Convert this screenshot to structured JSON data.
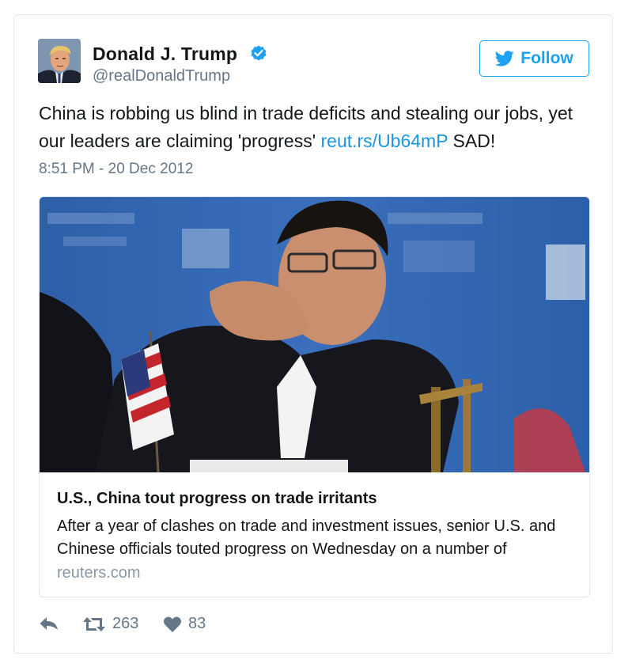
{
  "tweet": {
    "author": {
      "display_name": "Donald J. Trump",
      "handle": "@realDonaldTrump",
      "verified": true
    },
    "follow_label": "Follow",
    "text_before": "China is robbing us blind in trade deficits and stealing our jobs, yet our leaders are claiming 'progress' ",
    "link_text": "reut.rs/Ub64mP",
    "text_after": " SAD!",
    "timestamp": "8:51 PM - 20 Dec 2012",
    "card": {
      "title": "U.S., China tout progress on trade irritants",
      "description": "After a year of clashes on trade and investment issues, senior U.S. and Chinese officials touted progress on Wednesday on a number of",
      "domain": "reuters.com"
    },
    "actions": {
      "retweet_count": "263",
      "like_count": "83"
    }
  },
  "colors": {
    "accent": "#1da1f2",
    "link": "#1b95e0",
    "secondary_text": "#657786",
    "border": "#e1e8ed"
  },
  "icons": [
    "verified-icon",
    "twitter-bird-icon",
    "reply-icon",
    "retweet-icon",
    "heart-icon"
  ]
}
